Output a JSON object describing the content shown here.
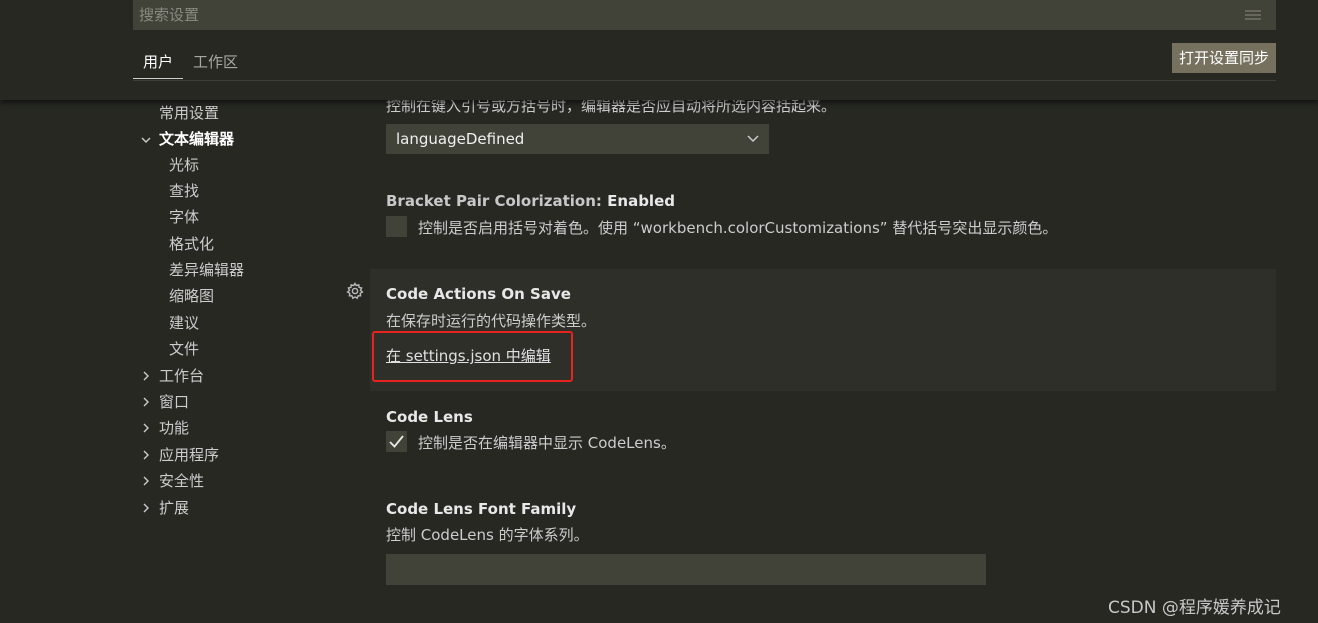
{
  "search": {
    "placeholder": "搜索设置"
  },
  "tabs": [
    {
      "label": "用户"
    },
    {
      "label": "工作区"
    }
  ],
  "sync_button": "打开设置同步",
  "toc": {
    "items": [
      {
        "label": "常用设置"
      },
      {
        "label": "文本编辑器"
      },
      {
        "label": "光标"
      },
      {
        "label": "查找"
      },
      {
        "label": "字体"
      },
      {
        "label": "格式化"
      },
      {
        "label": "差异编辑器"
      },
      {
        "label": "缩略图"
      },
      {
        "label": "建议"
      },
      {
        "label": "文件"
      },
      {
        "label": "工作台"
      },
      {
        "label": "窗口"
      },
      {
        "label": "功能"
      },
      {
        "label": "应用程序"
      },
      {
        "label": "安全性"
      },
      {
        "label": "扩展"
      }
    ]
  },
  "settings": {
    "auto_surround": {
      "description": "控制在键入引号或方括号时，编辑器是否应自动将所选内容括起来。",
      "value": "languageDefined"
    },
    "bracket_colorization": {
      "title_prefix": "Bracket Pair Colorization: ",
      "title_name": "Enabled",
      "description": "控制是否启用括号对着色。使用 “workbench.colorCustomizations” 替代括号突出显示颜色。",
      "checked": false
    },
    "code_actions_on_save": {
      "title": "Code Actions On Save",
      "description": "在保存时运行的代码操作类型。",
      "link": "在 settings.json 中编辑"
    },
    "code_lens": {
      "title": "Code Lens",
      "description": "控制是否在编辑器中显示 CodeLens。",
      "checked": true
    },
    "code_lens_font_family": {
      "title": "Code Lens Font Family",
      "description": "控制 CodeLens 的字体系列。",
      "value": ""
    }
  },
  "watermark": "CSDN @程序媛养成记",
  "colors": {
    "background": "#272822",
    "input_background": "#414339",
    "button_background": "#75715e",
    "highlight_box": "#e8231f"
  }
}
